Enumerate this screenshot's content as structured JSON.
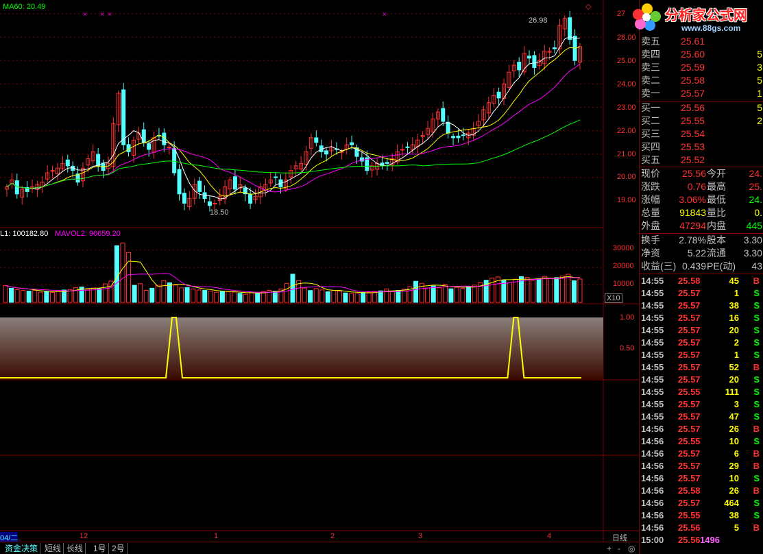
{
  "chart": {
    "ma_label": "MA60: 20.49",
    "high_label": "26.98",
    "low_label": "18.50",
    "price_ticks": [
      "27",
      "26.00",
      "25.00",
      "24.00",
      "23.00",
      "22.00",
      "21.00",
      "20.00",
      "19.00"
    ],
    "vol_label1": "L1: 100182.80",
    "vol_label2": "MAVOL2: 96659.20",
    "vol_ticks": [
      "30000",
      "20000",
      "10000"
    ],
    "vol_unit": "X10",
    "ind_ticks": [
      "1.00",
      "0.50"
    ],
    "date_labels": [
      "04/二",
      "12",
      "1",
      "2",
      "3",
      "4"
    ],
    "period_label": "日线",
    "colors": {
      "up": "#ff3232",
      "down": "#54ffff",
      "ma5": "#ffffff",
      "ma10": "#ffff00",
      "ma20": "#ff00ff",
      "ma60": "#00ff00",
      "grid": "#800000"
    }
  },
  "chart_data": {
    "type": "candlestick",
    "price_range": [
      18.5,
      27.0
    ],
    "closes": [
      19.6,
      19.9,
      19.3,
      19.5,
      19.4,
      19.6,
      19.7,
      19.8,
      20.2,
      20.3,
      20.4,
      20.6,
      20.5,
      20.3,
      19.8,
      20.4,
      20.8,
      21.1,
      20.5,
      20.3,
      20.6,
      22.3,
      23.6,
      21.4,
      21.1,
      21.6,
      21.9,
      21.5,
      21.2,
      21.7,
      21.8,
      21.4,
      21.3,
      20.2,
      19.3,
      18.9,
      19.1,
      19.7,
      19.4,
      19.1,
      18.8,
      18.9,
      19.2,
      19.6,
      19.9,
      19.5,
      19.7,
      19.3,
      18.9,
      19.2,
      19.6,
      19.7,
      19.9,
      20.0,
      19.6,
      19.9,
      20.3,
      20.5,
      20.6,
      21.1,
      21.7,
      21.5,
      21.1,
      21.0,
      21.3,
      21.2,
      21.1,
      21.4,
      21.4,
      20.9,
      20.7,
      20.3,
      20.5,
      20.6,
      20.5,
      20.6,
      20.8,
      21.1,
      21.2,
      21.3,
      21.4,
      21.6,
      21.8,
      22.1,
      22.5,
      22.8,
      22.4,
      21.9,
      21.7,
      21.7,
      21.8,
      21.9,
      22.1,
      22.4,
      22.9,
      23.2,
      23.5,
      23.4,
      24.0,
      24.5,
      24.8,
      24.6,
      25.3,
      25.1,
      24.7,
      25.0,
      25.4,
      25.4,
      25.5,
      26.5,
      26.8,
      25.9,
      25.0,
      25.6
    ],
    "volumes": [
      9600,
      8100,
      7300,
      6800,
      6500,
      6900,
      5900,
      6100,
      5700,
      6300,
      7100,
      7400,
      8500,
      8800,
      7600,
      8200,
      7900,
      10600,
      12200,
      32500,
      34100,
      28600,
      9800,
      10700,
      6900,
      8100,
      9800,
      12500,
      11200,
      9900,
      8300,
      8500,
      7600,
      7100,
      6900,
      6500,
      5800,
      6200,
      6100,
      5900,
      5200,
      4700,
      5600,
      5400,
      6300,
      6900,
      6400,
      7700,
      10900,
      16200,
      12500,
      8200,
      6800,
      7900,
      7100,
      6100,
      6800,
      6500,
      5400,
      5100,
      5200,
      5700,
      5900,
      6300,
      6600,
      7700,
      6400,
      6900,
      7500,
      8900,
      12100,
      10900,
      8300,
      9400,
      8400,
      10400,
      7800,
      8600,
      8100,
      9200,
      9900,
      11300,
      12700,
      13900,
      14600,
      12600,
      11200,
      13300,
      14800,
      14300,
      12600,
      13500,
      14900,
      13800,
      14200,
      15100,
      16100,
      12400,
      13400
    ],
    "indicator": {
      "levels": [
        0,
        1
      ],
      "spikes_at_index": [
        10,
        32
      ]
    }
  },
  "quote": {
    "sell": [
      {
        "label": "卖五",
        "price": "25.61",
        "vol": ""
      },
      {
        "label": "卖四",
        "price": "25.60",
        "vol": "5"
      },
      {
        "label": "卖三",
        "price": "25.59",
        "vol": "3"
      },
      {
        "label": "卖二",
        "price": "25.58",
        "vol": "5"
      },
      {
        "label": "卖一",
        "price": "25.57",
        "vol": "1"
      }
    ],
    "buy": [
      {
        "label": "买一",
        "price": "25.56",
        "vol": "5"
      },
      {
        "label": "买二",
        "price": "25.55",
        "vol": "2"
      },
      {
        "label": "买三",
        "price": "25.54",
        "vol": ""
      },
      {
        "label": "买四",
        "price": "25.53",
        "vol": ""
      },
      {
        "label": "买五",
        "price": "25.52",
        "vol": ""
      }
    ],
    "stats1": [
      {
        "l1": "现价",
        "v1": "25.56",
        "l2": "今开",
        "v2": "24."
      },
      {
        "l1": "涨跌",
        "v1": "0.76",
        "l2": "最高",
        "v2": "25."
      },
      {
        "l1": "涨幅",
        "v1": "3.06%",
        "l2": "最低",
        "v2": "24."
      },
      {
        "l1": "总量",
        "v1": "91843",
        "l2": "量比",
        "v2": "0."
      },
      {
        "l1": "外盘",
        "v1": "47294",
        "l2": "内盘",
        "v2": "445"
      }
    ],
    "stats2": [
      {
        "l1": "换手",
        "v1": "2.78%",
        "l2": "股本",
        "v2": "3.30"
      },
      {
        "l1": "净资",
        "v1": "5.22",
        "l2": "流通",
        "v2": "3.30"
      },
      {
        "l1": "收益(三)",
        "v1": "0.439",
        "l2": "PE(动)",
        "v2": "43"
      }
    ],
    "ticks": [
      {
        "t": "14:55",
        "p": "25.58",
        "v": "45",
        "d": "B"
      },
      {
        "t": "14:55",
        "p": "25.57",
        "v": "1",
        "d": "S"
      },
      {
        "t": "14:55",
        "p": "25.57",
        "v": "38",
        "d": "S"
      },
      {
        "t": "14:55",
        "p": "25.57",
        "v": "16",
        "d": "S"
      },
      {
        "t": "14:55",
        "p": "25.57",
        "v": "20",
        "d": "S"
      },
      {
        "t": "14:55",
        "p": "25.57",
        "v": "2",
        "d": "S"
      },
      {
        "t": "14:55",
        "p": "25.57",
        "v": "1",
        "d": "S"
      },
      {
        "t": "14:55",
        "p": "25.57",
        "v": "52",
        "d": "B"
      },
      {
        "t": "14:55",
        "p": "25.57",
        "v": "20",
        "d": "S"
      },
      {
        "t": "14:55",
        "p": "25.55",
        "v": "111",
        "d": "S"
      },
      {
        "t": "14:55",
        "p": "25.57",
        "v": "3",
        "d": "S"
      },
      {
        "t": "14:55",
        "p": "25.57",
        "v": "47",
        "d": "S"
      },
      {
        "t": "14:56",
        "p": "25.57",
        "v": "26",
        "d": "B"
      },
      {
        "t": "14:56",
        "p": "25.55",
        "v": "10",
        "d": "S"
      },
      {
        "t": "14:56",
        "p": "25.57",
        "v": "6",
        "d": "B"
      },
      {
        "t": "14:56",
        "p": "25.57",
        "v": "29",
        "d": "B"
      },
      {
        "t": "14:56",
        "p": "25.57",
        "v": "10",
        "d": "S"
      },
      {
        "t": "14:56",
        "p": "25.58",
        "v": "26",
        "d": "B"
      },
      {
        "t": "14:56",
        "p": "25.57",
        "v": "464",
        "d": "S"
      },
      {
        "t": "14:56",
        "p": "25.55",
        "v": "38",
        "d": "S"
      },
      {
        "t": "14:56",
        "p": "25.56",
        "v": "5",
        "d": "B"
      },
      {
        "t": "15:00",
        "p": "25.56",
        "v": "1496",
        "d": ""
      }
    ]
  },
  "logo": {
    "title": "分析家公式网",
    "url": "www.88gs.com"
  },
  "tabs": [
    "资金决策",
    "短线",
    "长线",
    "1号",
    "2号"
  ],
  "bottom_icons": [
    "+",
    "-",
    "◎"
  ]
}
